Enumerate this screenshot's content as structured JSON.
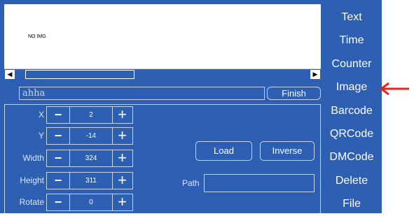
{
  "preview": {
    "placeholder_text": "NO IMG"
  },
  "scrollbar": {
    "left_arrow": "◀",
    "right_arrow": "▶"
  },
  "name_field": {
    "value": "ahha"
  },
  "finish_button": {
    "label": "Finish"
  },
  "properties": [
    {
      "label": "X",
      "value": "2"
    },
    {
      "label": "Y",
      "value": "-14"
    },
    {
      "label": "Width",
      "value": "324"
    },
    {
      "label": "Height",
      "value": "311"
    },
    {
      "label": "Rotate",
      "value": "0"
    }
  ],
  "stepper_symbols": {
    "minus": "−",
    "plus": "+"
  },
  "load_button": {
    "label": "Load"
  },
  "inverse_button": {
    "label": "Inverse"
  },
  "path": {
    "label": "Path",
    "value": ""
  },
  "menu": [
    "Text",
    "Time",
    "Counter",
    "Image",
    "Barcode",
    "QRCode",
    "DMCode",
    "Delete",
    "File"
  ],
  "colors": {
    "panel_bg": "#2d5fb3",
    "border": "#c9d4e8",
    "arrow": "#e0261b"
  },
  "icons": {
    "annotation_arrow": "left-arrow-icon"
  }
}
